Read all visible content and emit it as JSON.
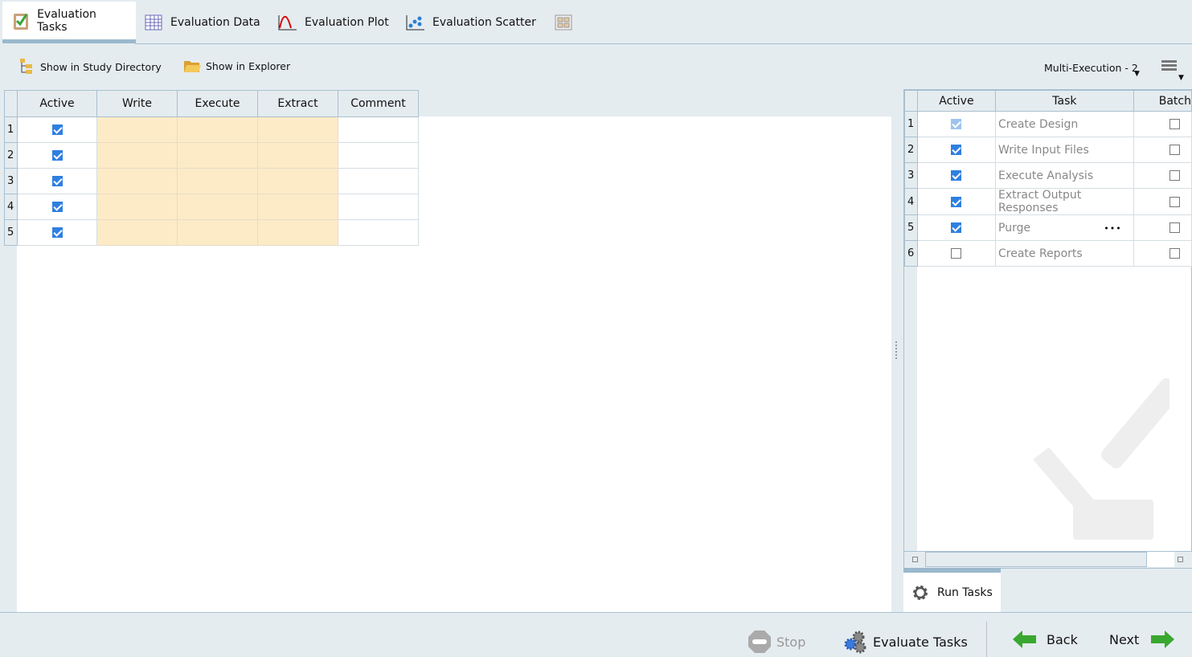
{
  "tabs": [
    {
      "label": "Evaluation Tasks"
    },
    {
      "label": "Evaluation Data"
    },
    {
      "label": "Evaluation Plot"
    },
    {
      "label": "Evaluation Scatter"
    }
  ],
  "toolbar": {
    "study_dir": "Show in Study Directory",
    "explorer": "Show in Explorer",
    "multi_exec": "Multi-Execution - 2"
  },
  "left_grid": {
    "columns": [
      "Active",
      "Write",
      "Execute",
      "Extract",
      "Comment"
    ],
    "rows": [
      {
        "n": "1",
        "active": true
      },
      {
        "n": "2",
        "active": true
      },
      {
        "n": "3",
        "active": true
      },
      {
        "n": "4",
        "active": true
      },
      {
        "n": "5",
        "active": true
      }
    ]
  },
  "right_grid": {
    "columns": [
      "Active",
      "Task",
      "Batch"
    ],
    "rows": [
      {
        "n": "1",
        "active": "disabled",
        "task": "Create Design",
        "batch": false
      },
      {
        "n": "2",
        "active": true,
        "task": "Write Input Files",
        "batch": false
      },
      {
        "n": "3",
        "active": true,
        "task": "Execute Analysis",
        "batch": false
      },
      {
        "n": "4",
        "active": true,
        "task": "Extract Output Responses",
        "batch": false
      },
      {
        "n": "5",
        "active": true,
        "task": "Purge",
        "batch": false,
        "more": "•••"
      },
      {
        "n": "6",
        "active": false,
        "task": "Create Reports",
        "batch": false
      }
    ]
  },
  "run_tasks": "Run Tasks",
  "footer": {
    "stop": "Stop",
    "evaluate": "Evaluate Tasks",
    "back": "Back",
    "next": "Next"
  }
}
